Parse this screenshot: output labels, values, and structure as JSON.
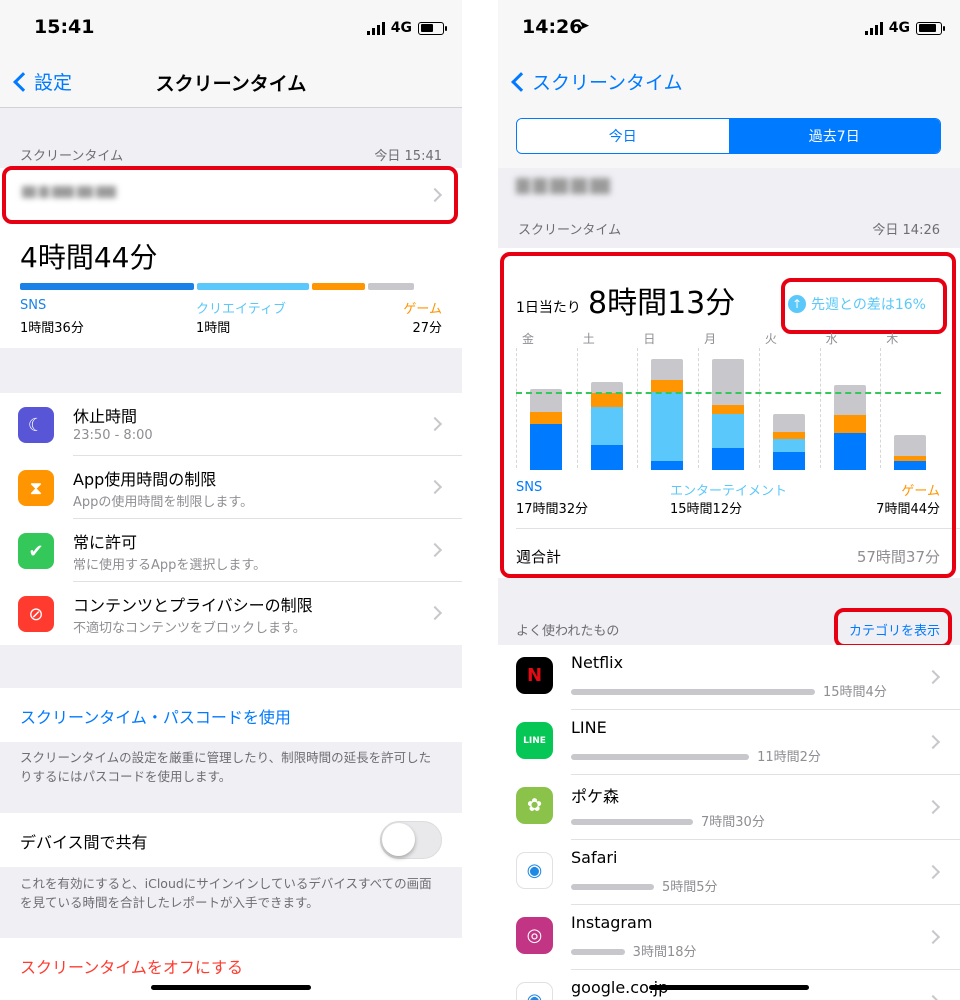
{
  "left": {
    "status": {
      "time": "15:41",
      "network": "4G"
    },
    "nav": {
      "back_label": "設定",
      "title": "スクリーンタイム"
    },
    "section": {
      "label": "スクリーンタイム",
      "time": "今日 15:41"
    },
    "total": "4時間44分",
    "usage_bar": [
      {
        "fraction": 0.42,
        "color": "#1a82e6"
      },
      {
        "fraction": 0.27,
        "color": "#5ac8fa"
      },
      {
        "fraction": 0.13,
        "color": "#ff9500"
      },
      {
        "fraction": 0.11,
        "color": "#c7c7cc"
      }
    ],
    "categories": [
      {
        "label": "SNS",
        "value": "1時間36分",
        "color": "#1a82e6"
      },
      {
        "label": "クリエイティブ",
        "value": "1時間",
        "color": "#5ac8fa"
      },
      {
        "label": "ゲーム",
        "value": "27分",
        "color": "#ff9500"
      }
    ],
    "settings": [
      {
        "title": "休止時間",
        "subtitle": "23:50 - 8:00",
        "icon": "downtime-icon",
        "icon_color": "#5856d6"
      },
      {
        "title": "App使用時間の制限",
        "subtitle": "Appの使用時間を制限します。",
        "icon": "hourglass-icon",
        "icon_color": "#ff9500"
      },
      {
        "title": "常に許可",
        "subtitle": "常に使用するAppを選択します。",
        "icon": "checkmark-icon",
        "icon_color": "#34c759"
      },
      {
        "title": "コンテンツとプライバシーの制限",
        "subtitle": "不適切なコンテンツをブロックします。",
        "icon": "prohibited-icon",
        "icon_color": "#ff3b30"
      }
    ],
    "passcode_link": "スクリーンタイム・パスコードを使用",
    "passcode_note": "スクリーンタイムの設定を厳重に管理したり、制限時間の延長を許可したりするにはパスコードを使用します。",
    "share_label": "デバイス間で共有",
    "share_note": "これを有効にすると、iCloudにサインインしているデバイスすべての画面を見ている時間を合計したレポートが入手できます。",
    "turn_off": "スクリーンタイムをオフにする"
  },
  "right": {
    "status": {
      "time": "14:26",
      "network": "4G"
    },
    "nav": {
      "back_label": "スクリーンタイム"
    },
    "segments": [
      "今日",
      "過去7日"
    ],
    "section": {
      "label": "スクリーンタイム",
      "time": "今日 14:26"
    },
    "daily_avg_label": "1日当たり",
    "daily_avg": "8時間13分",
    "compare": "先週との差は16%",
    "week_chart": {
      "days": [
        "金",
        "土",
        "日",
        "月",
        "火",
        "水",
        "木"
      ],
      "max_minutes": 780,
      "avg_minutes": 493,
      "colors": [
        "#007aff",
        "#5ac8fa",
        "#ff9500",
        "#c7c7cc"
      ],
      "stacks": [
        [
          300,
          0,
          75,
          150
        ],
        [
          160,
          250,
          90,
          75
        ],
        [
          60,
          450,
          75,
          135
        ],
        [
          140,
          225,
          55,
          300
        ],
        [
          120,
          80,
          45,
          120
        ],
        [
          240,
          0,
          120,
          195
        ],
        [
          60,
          0,
          30,
          135
        ]
      ]
    },
    "categories": [
      {
        "label": "SNS",
        "value": "17時間32分",
        "color": "#007aff"
      },
      {
        "label": "エンターテイメント",
        "value": "15時間12分",
        "color": "#5ac8fa"
      },
      {
        "label": "ゲーム",
        "value": "7時間44分",
        "color": "#ff9500"
      }
    ],
    "week_total_label": "週合計",
    "week_total": "57時間37分",
    "most_used_label": "よく使われたもの",
    "show_categories": "カテゴリを表示",
    "apps": [
      {
        "name": "Netflix",
        "time": "15時間4分",
        "fraction": 1.0,
        "icon": "netflix-icon",
        "icon_color": "#000000",
        "glyph": "N",
        "glyph_color": "#e50914"
      },
      {
        "name": "LINE",
        "time": "11時間2分",
        "fraction": 0.73,
        "icon": "line-icon",
        "icon_color": "#06c755",
        "glyph": "LINE",
        "glyph_color": "#ffffff"
      },
      {
        "name": "ポケ森",
        "time": "7時間30分",
        "fraction": 0.5,
        "icon": "pocket-camp-icon",
        "icon_color": "#8bc34a",
        "glyph": "✿",
        "glyph_color": "#ffffff"
      },
      {
        "name": "Safari",
        "time": "5時間5分",
        "fraction": 0.34,
        "icon": "safari-icon",
        "icon_color": "#ffffff",
        "glyph": "◉",
        "glyph_color": "#1e88e5"
      },
      {
        "name": "Instagram",
        "time": "3時間18分",
        "fraction": 0.22,
        "icon": "instagram-icon",
        "icon_color": "#c13584",
        "glyph": "◎",
        "glyph_color": "#ffffff"
      },
      {
        "name": "google.co.jp",
        "time": "",
        "fraction": 0,
        "icon": "safari-icon",
        "icon_color": "#ffffff",
        "glyph": "◉",
        "glyph_color": "#1e88e5"
      }
    ]
  }
}
